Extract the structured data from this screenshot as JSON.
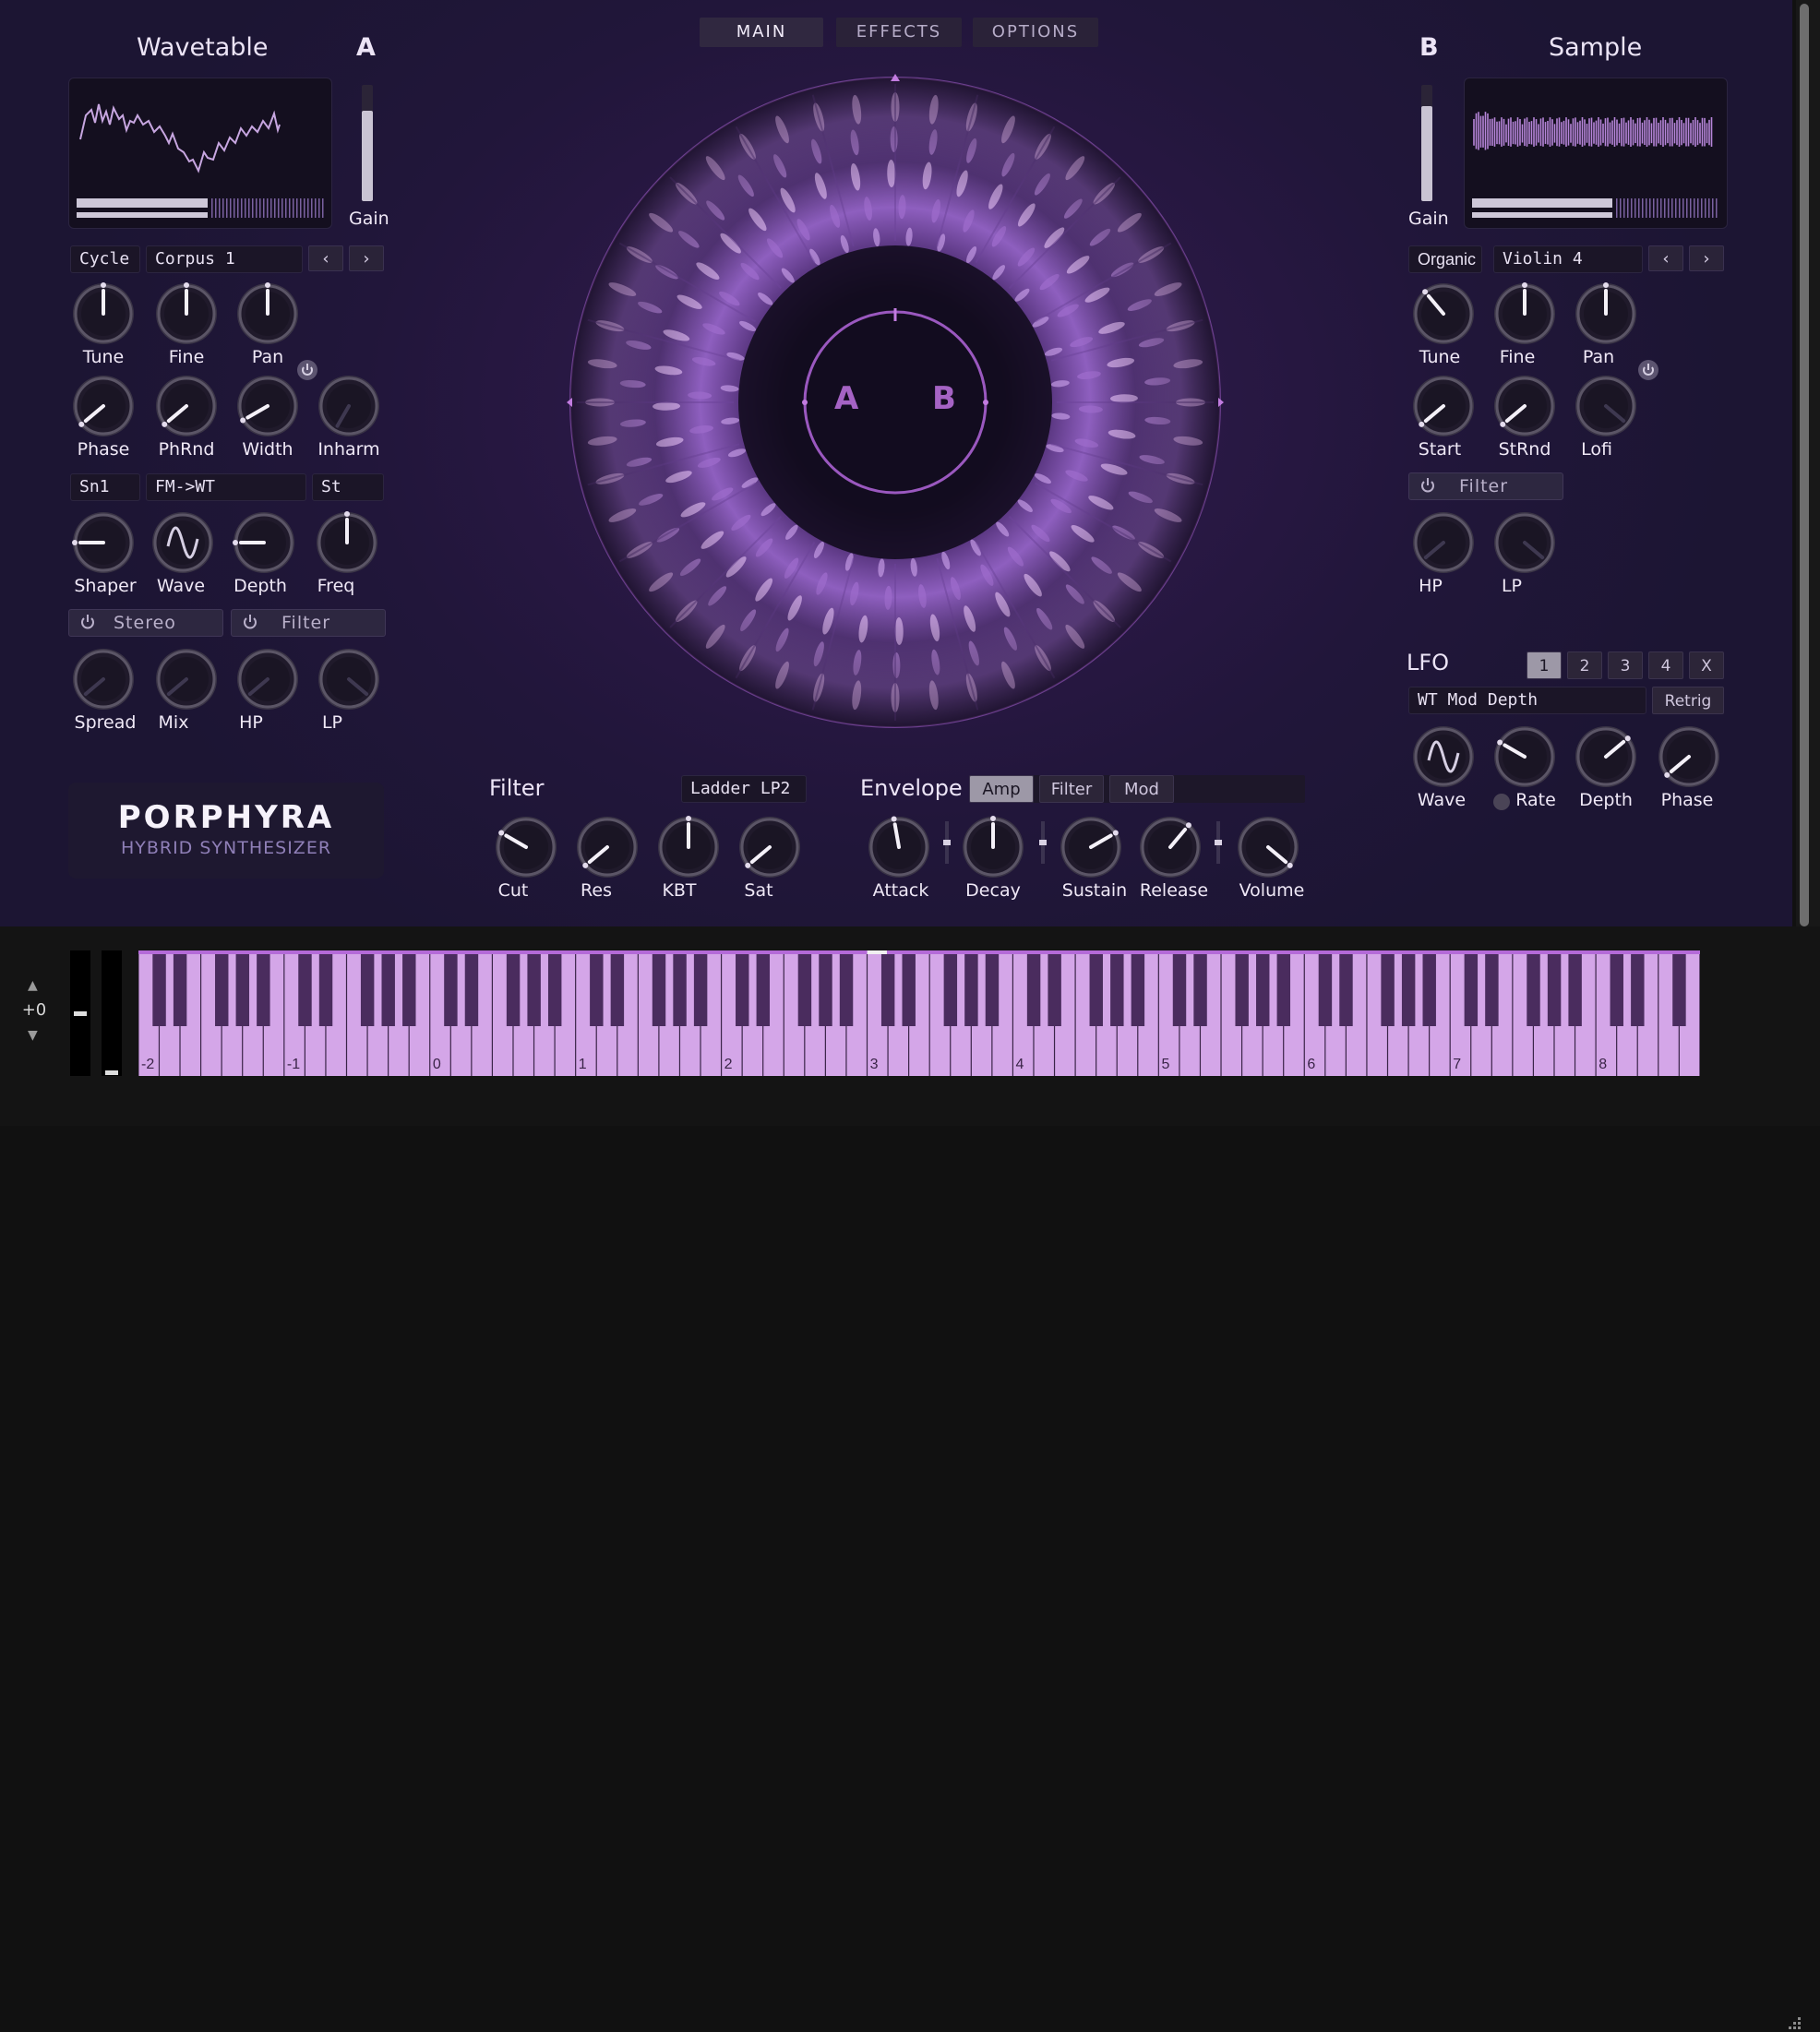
{
  "tabs": [
    "MAIN",
    "EFFECTS",
    "OPTIONS"
  ],
  "active_tab": "MAIN",
  "osc_a": {
    "title": "Wavetable",
    "letter": "A",
    "gain_label": "Gain",
    "gain_level": 0.78,
    "position": 0.52,
    "category": "Cycle",
    "preset": "Corpus 1",
    "prev": "‹",
    "next": "›",
    "knobs_row1": [
      "Tune",
      "Fine",
      "Pan"
    ],
    "knobs_row2": [
      "Phase",
      "PhRnd",
      "Width",
      "Inharm"
    ],
    "shaper_mode": "Sn1",
    "mod_mode": "FM->WT",
    "freq_mode": "St",
    "knobs_row3": [
      "Shaper",
      "Wave",
      "Depth",
      "Freq"
    ],
    "stereo_label": "Stereo",
    "filter_label": "Filter",
    "knobs_row4": [
      "Spread",
      "Mix",
      "HP",
      "LP"
    ]
  },
  "osc_b": {
    "title": "Sample",
    "letter": "B",
    "gain_label": "Gain",
    "gain_level": 0.82,
    "position": 0.57,
    "category": "Organic",
    "preset": "Violin 4",
    "prev": "‹",
    "next": "›",
    "knobs_row1": [
      "Tune",
      "Fine",
      "Pan"
    ],
    "knobs_row2": [
      "Start",
      "StRnd",
      "Lofi"
    ],
    "filter_label": "Filter",
    "knobs_row3": [
      "HP",
      "LP"
    ]
  },
  "center": {
    "label_a": "A",
    "label_b": "B"
  },
  "logo": {
    "name": "PORPHYRA",
    "subtitle": "HYBRID SYNTHESIZER"
  },
  "filter": {
    "title": "Filter",
    "type": "Ladder LP2",
    "knobs": [
      "Cut",
      "Res",
      "KBT",
      "Sat"
    ]
  },
  "envelope": {
    "title": "Envelope",
    "tabs": [
      "Amp",
      "Filter",
      "Mod"
    ],
    "active": "Amp",
    "knobs": [
      "Attack",
      "Decay",
      "Sustain",
      "Release",
      "Volume"
    ]
  },
  "lfo": {
    "title": "LFO",
    "slots": [
      "1",
      "2",
      "3",
      "4",
      "X"
    ],
    "active_slot": "1",
    "target": "WT Mod Depth",
    "retrig": "Retrig",
    "knobs": [
      "Wave",
      "Rate",
      "Depth",
      "Phase"
    ]
  },
  "keyboard": {
    "octave_shift": "+0",
    "up": "▲",
    "down": "▼",
    "octave_labels": [
      "-2",
      "-1",
      "0",
      "1",
      "2",
      "3",
      "4",
      "5",
      "6",
      "7",
      "8"
    ],
    "pitch_wheel": 0.5,
    "mod_wheel": 0.0
  },
  "colors": {
    "accent": "#c58ee6",
    "key_white": "#d4a6e8",
    "key_black": "#4a2c5e",
    "panel": "#231839"
  }
}
